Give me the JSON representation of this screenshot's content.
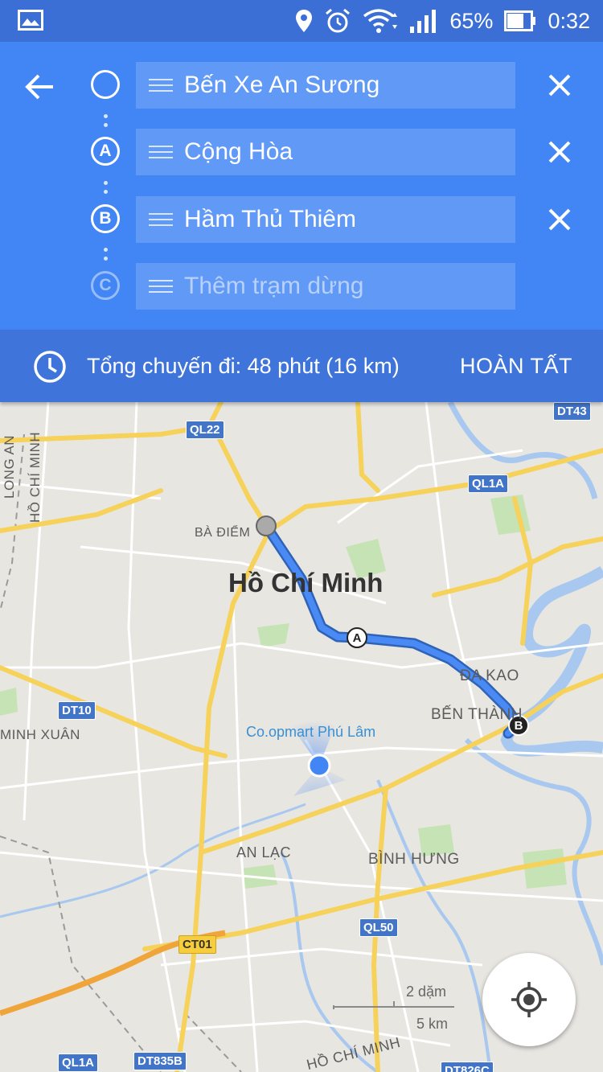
{
  "status_bar": {
    "battery": "65%",
    "time": "0:32"
  },
  "directions": {
    "stops": [
      {
        "marker": "",
        "label": "Bến Xe An Sương"
      },
      {
        "marker": "A",
        "label": "Cộng Hòa"
      },
      {
        "marker": "B",
        "label": "Hầm Thủ Thiêm"
      }
    ],
    "add_stop": {
      "marker": "C",
      "placeholder": "Thêm trạm dừng"
    }
  },
  "summary": {
    "text": "Tổng chuyến đi: 48 phút  (16 km)",
    "done_label": "HOÀN TẤT"
  },
  "map": {
    "city": "Hồ Chí Minh",
    "labels": {
      "ba_diem": "BÀ ĐIỂM",
      "da_kao": "ĐA KAO",
      "ben_thanh": "BẾN THÀNH",
      "an_lac": "AN LẠC",
      "binh_hung": "BÌNH HƯNG",
      "minh_xuan": "MINH XUÂN",
      "long_an": "LONG AN",
      "ho_chi_minh_v": "HỒ CHÍ MINH",
      "ho_chi_minh_bottom": "HỒ CHÍ MINH"
    },
    "poi": "Co.opmart Phú Lâm",
    "shields": {
      "ql22": "QL22",
      "ql1a_top": "QL1A",
      "dt43": "DT43",
      "dt10": "DT10",
      "ql50": "QL50",
      "ct01": "CT01",
      "ql1a_bottom": "QL1A",
      "dt835b": "DT835B",
      "dt826c": "DT826C"
    },
    "route_markers": {
      "a": "A",
      "b": "B"
    },
    "scale": {
      "top": "2 dặm",
      "bottom": "5 km"
    },
    "colors": {
      "route": "#4a8af4",
      "water": "#a8c8f0",
      "park": "#c6e3b5"
    }
  }
}
